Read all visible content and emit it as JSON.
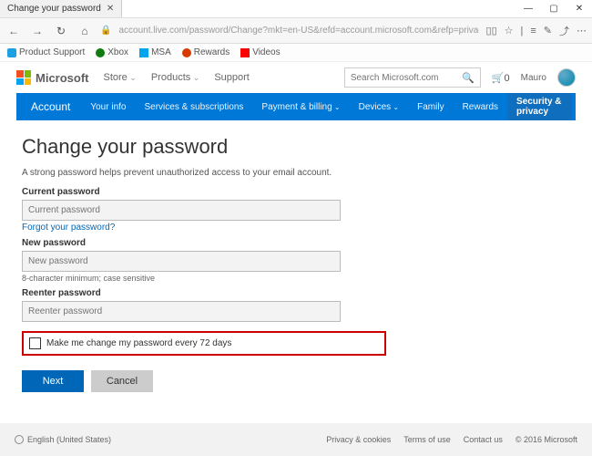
{
  "browser": {
    "tab_title": "Change your password",
    "url": "account.live.com/password/Change?mkt=en-US&refd=account.microsoft.com&refp=privacy",
    "favorites": [
      "Product Support",
      "Xbox",
      "MSA",
      "Rewards",
      "Videos"
    ]
  },
  "ms_header": {
    "brand": "Microsoft",
    "nav": {
      "store": "Store",
      "products": "Products",
      "support": "Support"
    },
    "search_placeholder": "Search Microsoft.com",
    "cart_count": "0",
    "user": "Mauro"
  },
  "bluebar": {
    "account": "Account",
    "your_info": "Your info",
    "services": "Services & subscriptions",
    "payment": "Payment & billing",
    "devices": "Devices",
    "family": "Family",
    "rewards": "Rewards",
    "security": "Security & privacy"
  },
  "form": {
    "heading": "Change your password",
    "intro": "A strong password helps prevent unauthorized access to your email account.",
    "current_label": "Current password",
    "current_ph": "Current password",
    "forgot": "Forgot your password?",
    "new_label": "New password",
    "new_ph": "New password",
    "hint": "8-character minimum; case sensitive",
    "reenter_label": "Reenter password",
    "reenter_ph": "Reenter password",
    "checkbox": "Make me change my password every 72 days",
    "next": "Next",
    "cancel": "Cancel"
  },
  "footer": {
    "lang": "English (United States)",
    "privacy": "Privacy & cookies",
    "terms": "Terms of use",
    "contact": "Contact us",
    "copyright": "© 2016 Microsoft"
  }
}
